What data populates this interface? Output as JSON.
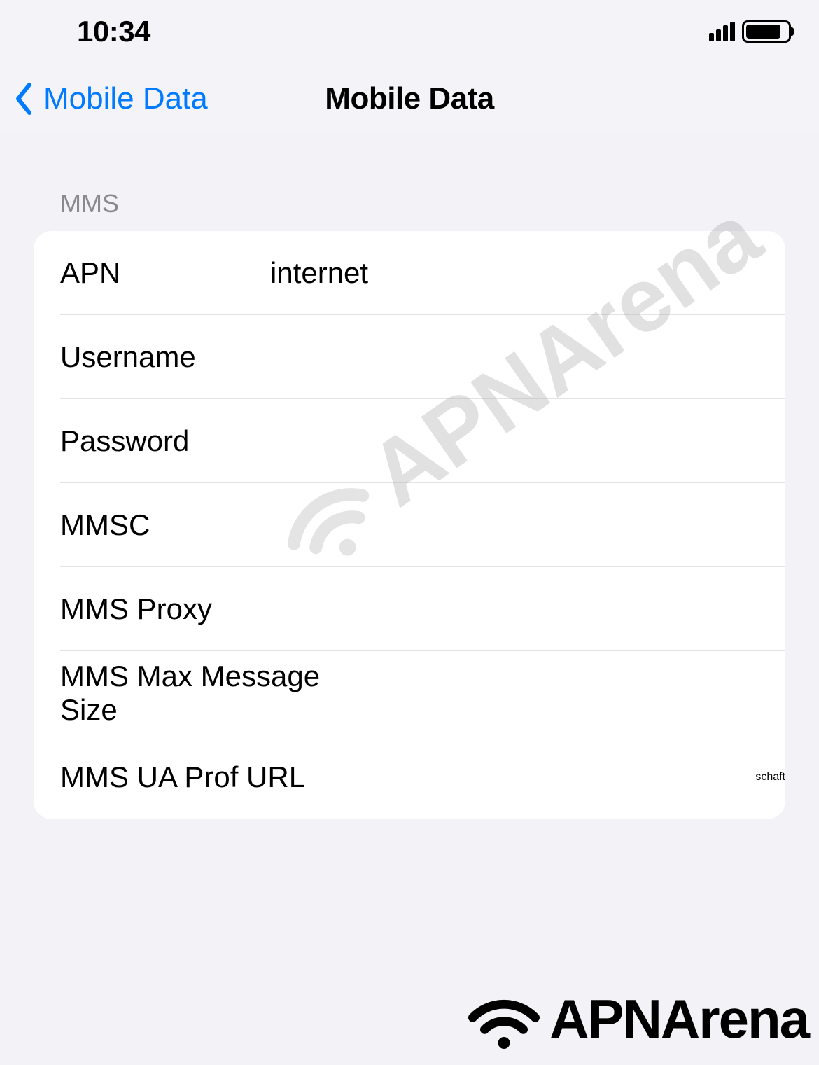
{
  "status": {
    "time": "10:34"
  },
  "nav": {
    "back_label": "Mobile Data",
    "title": "Mobile Data"
  },
  "section": {
    "header": "MMS",
    "rows": [
      {
        "label": "APN",
        "value": "internet"
      },
      {
        "label": "Username",
        "value": ""
      },
      {
        "label": "Password",
        "value": ""
      },
      {
        "label": "MMSC",
        "value": ""
      },
      {
        "label": "MMS Proxy",
        "value": ""
      },
      {
        "label": "MMS Max Message Size",
        "value": ""
      },
      {
        "label": "MMS UA Prof URL",
        "value": ""
      }
    ]
  },
  "watermark": {
    "text": "APNArena"
  },
  "brand": {
    "text": "APNArena"
  }
}
